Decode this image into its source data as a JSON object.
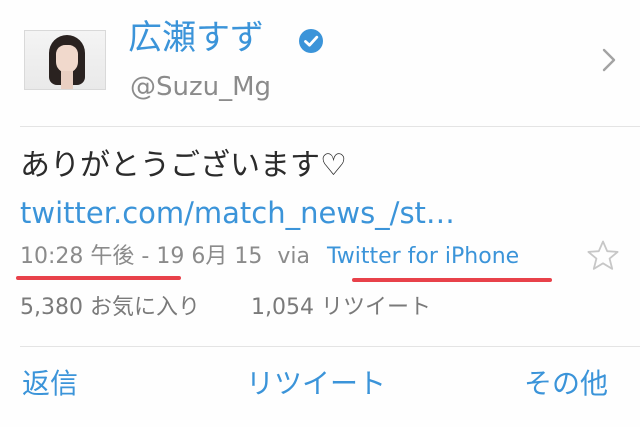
{
  "user": {
    "display_name": "広瀬すず",
    "handle": "@Suzu_Mg",
    "verified": true
  },
  "tweet": {
    "text": "ありがとうございます♡",
    "link": "twitter.com/match_news_/st…",
    "time": "10:28 午後",
    "date": "- 19 6月 15",
    "via": "via",
    "source": "Twitter for iPhone"
  },
  "stats": {
    "favorites": "5,380 お気に入り",
    "retweets": "1,054 リツイート"
  },
  "actions": {
    "reply": "返信",
    "retweet": "リツイート",
    "more": "その他"
  },
  "colors": {
    "accent": "#3b94d9",
    "annotation": "#e8414a",
    "text": "#2b2b2b",
    "muted": "#8b8b8b"
  },
  "icons": [
    "verified-badge-icon",
    "chevron-right-icon",
    "star-icon"
  ]
}
